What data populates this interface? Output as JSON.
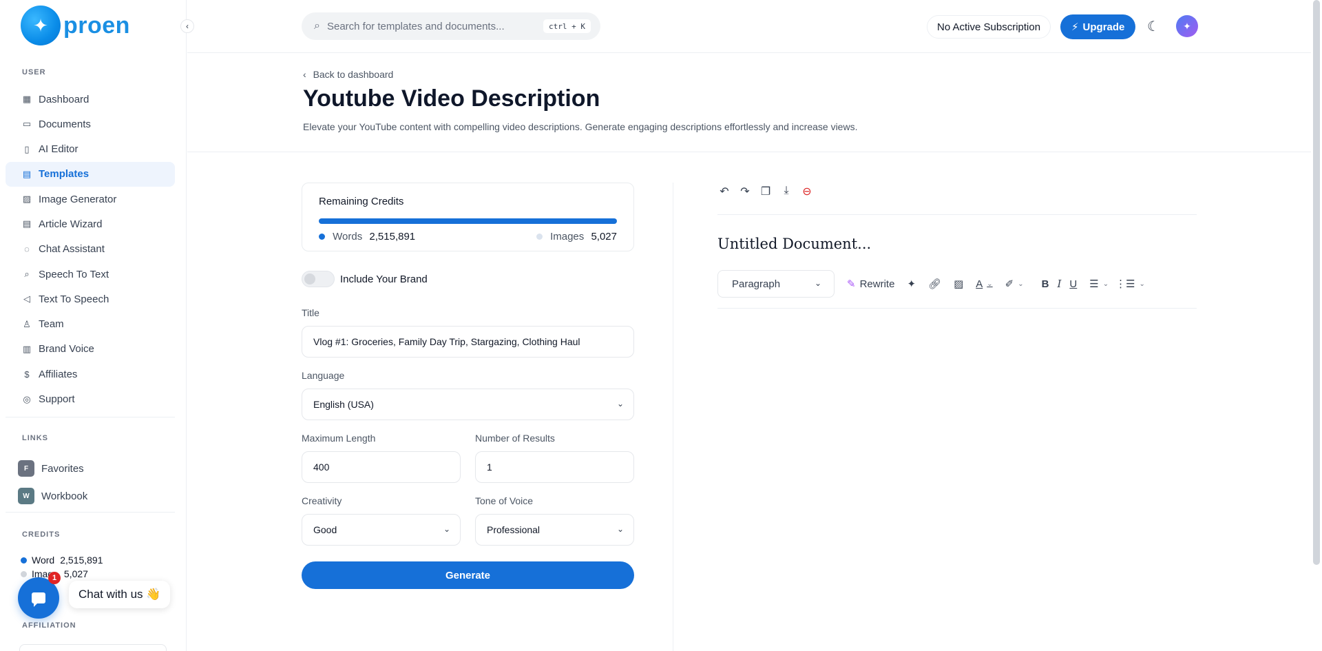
{
  "brand": {
    "name": "proen",
    "logo_glyph": "✦"
  },
  "sidebar": {
    "user_label": "USER",
    "items": [
      {
        "label": "Dashboard",
        "icon": "grid-icon",
        "glyph": "▦"
      },
      {
        "label": "Documents",
        "icon": "archive-icon",
        "glyph": "▭"
      },
      {
        "label": "AI Editor",
        "icon": "book-icon",
        "glyph": "▯"
      },
      {
        "label": "Templates",
        "icon": "file-text-icon",
        "glyph": "▤",
        "active": true
      },
      {
        "label": "Image Generator",
        "icon": "image-icon",
        "glyph": "▨"
      },
      {
        "label": "Article Wizard",
        "icon": "file-edit-icon",
        "glyph": "▤"
      },
      {
        "label": "Chat Assistant",
        "icon": "message-icon",
        "glyph": "◌"
      },
      {
        "label": "Speech To Text",
        "icon": "mic-icon",
        "glyph": "⌕"
      },
      {
        "label": "Text To Speech",
        "icon": "speaker-icon",
        "glyph": "◁"
      },
      {
        "label": "Team",
        "icon": "user-plus-icon",
        "glyph": "♙"
      },
      {
        "label": "Brand Voice",
        "icon": "columns-icon",
        "glyph": "▥"
      },
      {
        "label": "Affiliates",
        "icon": "dollar-icon",
        "glyph": "$"
      },
      {
        "label": "Support",
        "icon": "lifebuoy-icon",
        "glyph": "◎"
      }
    ],
    "links_label": "LINKS",
    "links": [
      {
        "letter": "F",
        "label": "Favorites",
        "color": "#6b7280"
      },
      {
        "letter": "W",
        "label": "Workbook",
        "color": "#5b7a84"
      }
    ],
    "credits_label": "CREDITS",
    "credits": [
      {
        "label": "Word",
        "value": "2,515,891",
        "color": "#1670d8"
      },
      {
        "label": "Image",
        "value": "5,027",
        "color": "#d1d5db"
      }
    ],
    "affiliation_label": "AFFILIATION"
  },
  "chat": {
    "badge": "1",
    "label": "Chat with us 👋"
  },
  "topbar": {
    "search_placeholder": "Search for templates and documents...",
    "shortcut": "ctrl + K",
    "subscription": "No Active Subscription",
    "upgrade_label": "Upgrade",
    "upgrade_icon": "⚡"
  },
  "header": {
    "back_label": "Back to dashboard",
    "title": "Youtube Video Description",
    "description": "Elevate your YouTube content with compelling video descriptions. Generate engaging descriptions effortlessly and increase views."
  },
  "form": {
    "credits_title": "Remaining Credits",
    "words_label": "Words",
    "words_value": "2,515,891",
    "images_label": "Images",
    "images_value": "5,027",
    "include_brand_label": "Include Your Brand",
    "include_brand_on": false,
    "title_label": "Title",
    "title_value": "Vlog #1: Groceries, Family Day Trip, Stargazing, Clothing Haul",
    "language_label": "Language",
    "language_value": "English (USA)",
    "max_length_label": "Maximum Length",
    "max_length_value": "400",
    "results_label": "Number of Results",
    "results_value": "1",
    "creativity_label": "Creativity",
    "creativity_value": "Good",
    "tone_label": "Tone of Voice",
    "tone_value": "Professional",
    "generate_label": "Generate"
  },
  "editor": {
    "doc_title": "Untitled Document...",
    "paragraph_label": "Paragraph",
    "rewrite_label": "Rewrite"
  }
}
